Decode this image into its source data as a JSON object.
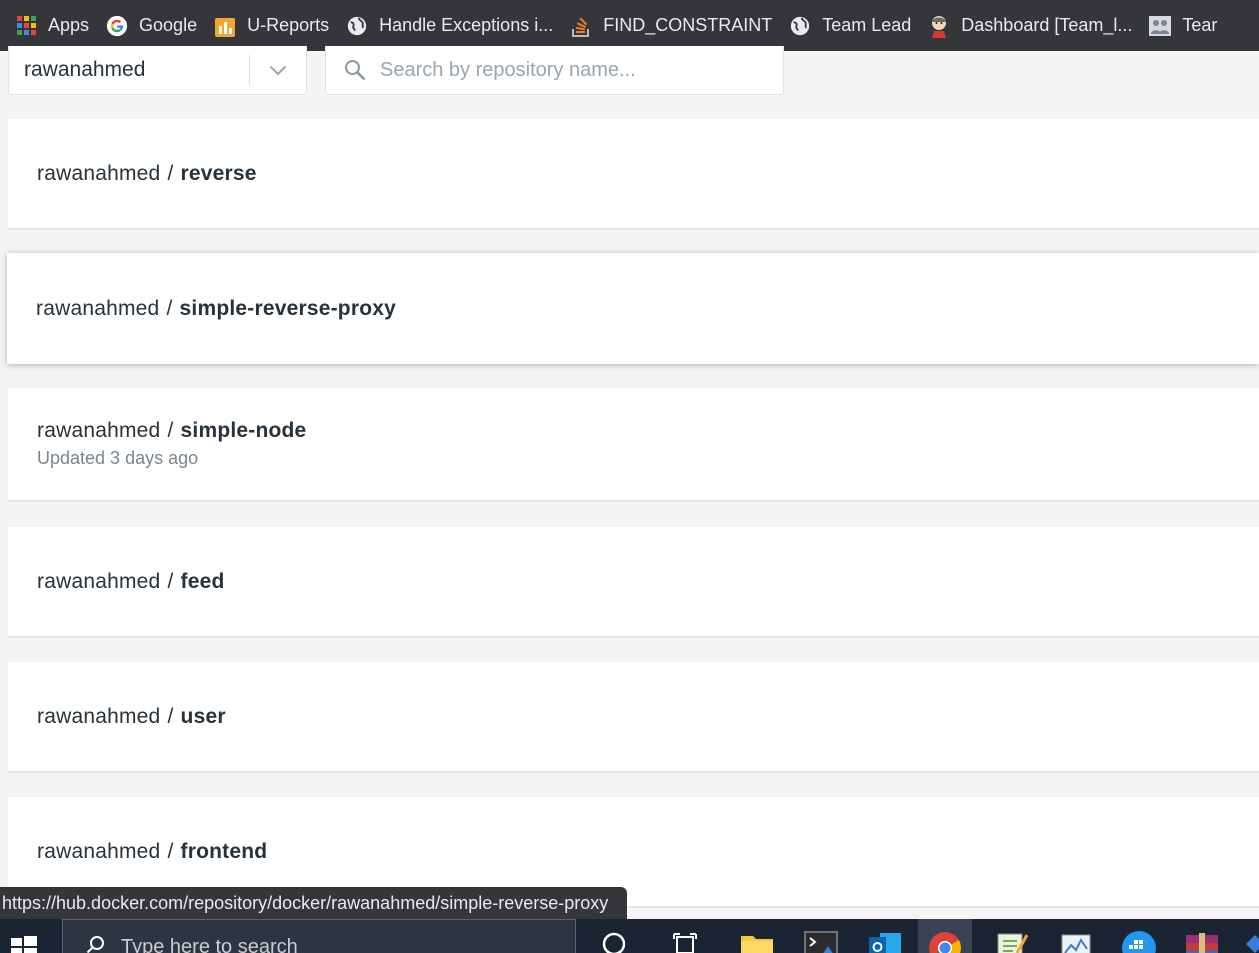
{
  "bookmarks": [
    {
      "label": "Apps",
      "icon": "apps-grid-icon"
    },
    {
      "label": "Google",
      "icon": "google-icon"
    },
    {
      "label": "U-Reports",
      "icon": "reports-icon"
    },
    {
      "label": "Handle Exceptions i...",
      "icon": "globe-icon"
    },
    {
      "label": "FIND_CONSTRAINT",
      "icon": "stackoverflow-icon"
    },
    {
      "label": "Team Lead",
      "icon": "globe-icon"
    },
    {
      "label": "Dashboard [Team_l...",
      "icon": "jenkins-icon"
    },
    {
      "label": "Tear",
      "icon": "team-icon"
    }
  ],
  "filter": {
    "namespace": "rawanahmed",
    "search_placeholder": "Search by repository name..."
  },
  "repositories": [
    {
      "namespace": "rawanahmed",
      "separator": "/",
      "name": "reverse",
      "updated": ""
    },
    {
      "namespace": "rawanahmed",
      "separator": "/",
      "name": "simple-reverse-proxy",
      "updated": ""
    },
    {
      "namespace": "rawanahmed",
      "separator": "/",
      "name": "simple-node",
      "updated": "Updated 3 days ago"
    },
    {
      "namespace": "rawanahmed",
      "separator": "/",
      "name": "feed",
      "updated": ""
    },
    {
      "namespace": "rawanahmed",
      "separator": "/",
      "name": "user",
      "updated": ""
    },
    {
      "namespace": "rawanahmed",
      "separator": "/",
      "name": "frontend",
      "updated": ""
    }
  ],
  "status_url": "https://hub.docker.com/repository/docker/rawanahmed/simple-reverse-proxy",
  "taskbar": {
    "search_placeholder": "Type here to search"
  },
  "colors": {
    "bookmark_bar": "#35363a",
    "page_background": "#f4f4f4",
    "card_background": "#ffffff",
    "taskbar": "#1b2432",
    "text": "#27323a",
    "muted_text": "#7a868f"
  }
}
